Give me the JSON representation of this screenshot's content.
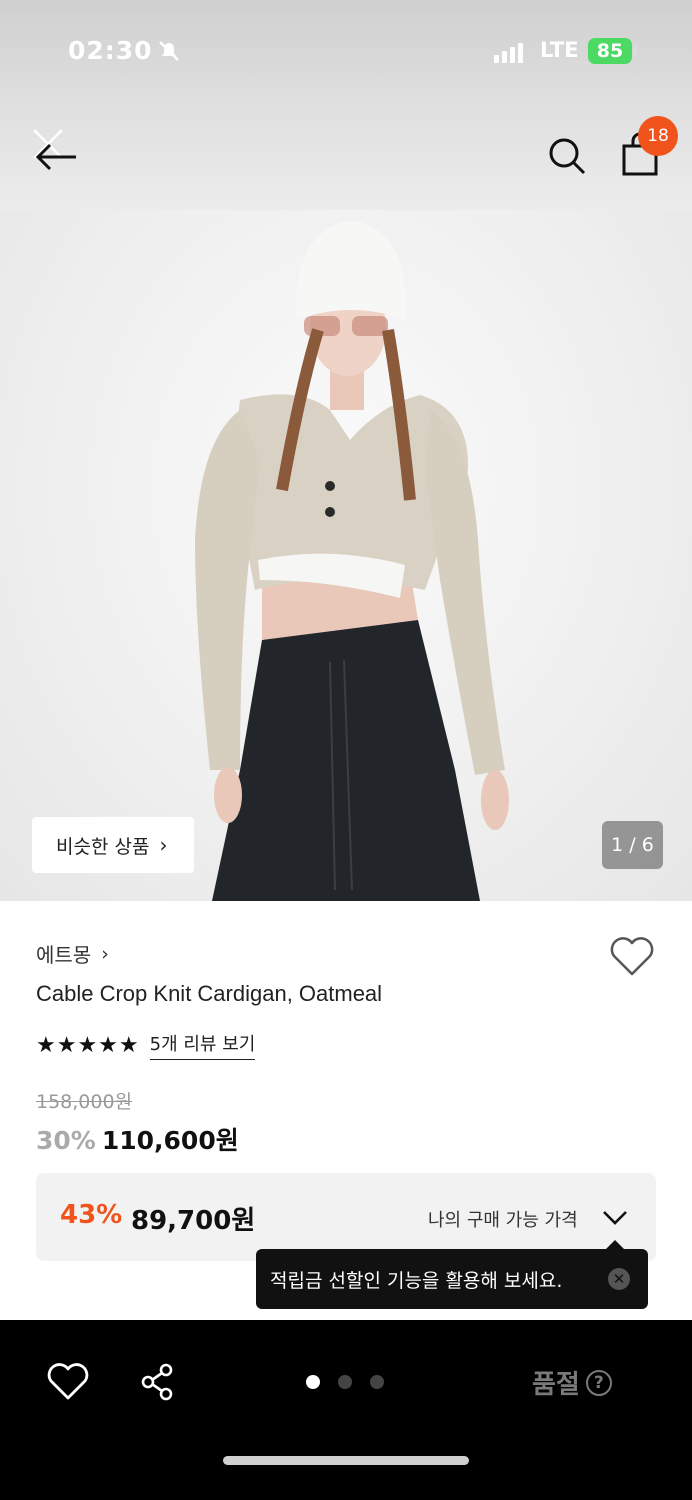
{
  "status_bar": {
    "time": "02:30",
    "network": "LTE",
    "battery": "85"
  },
  "header": {
    "cart_count": "18"
  },
  "gallery": {
    "similar_label": "비슷한 상품",
    "counter": "1 / 6"
  },
  "product": {
    "brand": "에트몽",
    "title": "Cable Crop Knit Cardigan, Oatmeal",
    "stars": "★★★★★",
    "rating": 5,
    "reviews_label": "5개 리뷰 보기",
    "original_price": "158,000원",
    "sale_percent": "30%",
    "sale_price": "110,600원"
  },
  "my_price": {
    "percent": "43%",
    "price": "89,700원",
    "label": "나의 구매 가능 가격"
  },
  "tooltip": {
    "text": "적립금 선할인 기능을 활용해 보세요."
  },
  "bottom": {
    "status_label": "품절",
    "help_glyph": "?",
    "page_dots": 3,
    "active_dot": 0
  },
  "colors": {
    "accent": "#f0531c",
    "badge": "#f0531c",
    "bottom_bar": "#000000"
  },
  "icons": [
    "close-icon",
    "back-arrow-icon",
    "search-icon",
    "shopping-bag-icon",
    "heart-icon",
    "share-icon",
    "help-icon",
    "chevron-down-icon"
  ]
}
